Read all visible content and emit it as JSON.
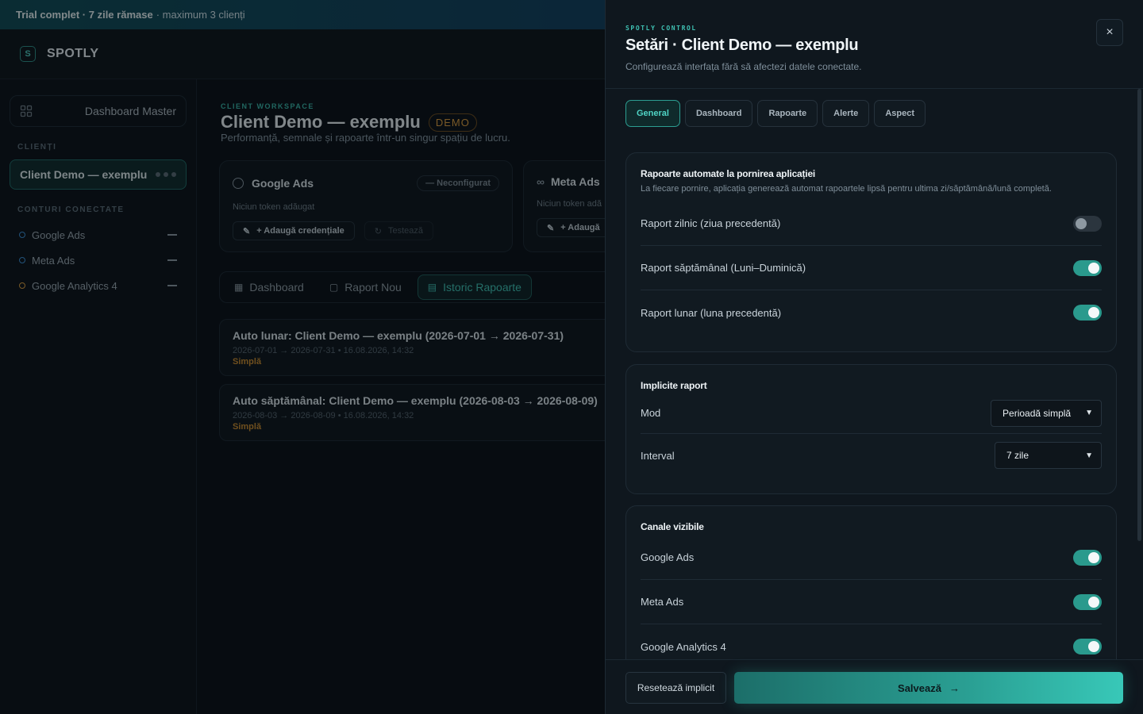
{
  "trial": {
    "bold": "Trial complet · 7 zile rămase",
    "rest": "· maximum 3 clienți"
  },
  "brand": {
    "logo": "S",
    "name": "SPOTLY"
  },
  "sidebar": {
    "dashboard_master": "Dashboard Master",
    "clients_label": "CLIENȚI",
    "active_client": "Client Demo — exemplu",
    "connected_label": "CONTURI CONECTATE",
    "accounts": [
      {
        "name": "Google Ads",
        "color": "#3b8fd6"
      },
      {
        "name": "Meta Ads",
        "color": "#3b8fd6"
      },
      {
        "name": "Google Analytics 4",
        "color": "#d99b3e"
      }
    ]
  },
  "workspace": {
    "label": "CLIENT WORKSPACE",
    "title": "Client Demo — exemplu",
    "badge": "DEMO",
    "subtitle": "Performanță, semnale și rapoarte într-un singur spațiu de lucru."
  },
  "cards": [
    {
      "name": "Google Ads",
      "status": "— Neconfigurat",
      "token": "Niciun token adăugat",
      "add": "+ Adaugă credențiale",
      "test": "Testează"
    },
    {
      "name": "Meta Ads",
      "token": "Niciun token adă",
      "add": "+ Adaugă"
    }
  ],
  "main_tabs": [
    "Dashboard",
    "Raport Nou",
    "Istoric Rapoarte"
  ],
  "reports": [
    {
      "title": "Auto lunar: Client Demo — exemplu (2026-07-01 → 2026-07-31)",
      "meta": "2026-07-01 → 2026-07-31 • 16.08.2026, 14:32",
      "kind": "Simplă"
    },
    {
      "title": "Auto săptămânal: Client Demo — exemplu (2026-08-03 → 2026-08-09)",
      "meta": "2026-08-03 → 2026-08-09 • 16.08.2026, 14:32",
      "kind": "Simplă"
    }
  ],
  "drawer": {
    "kicker": "SPOTLY CONTROL",
    "title": "Setări · Client Demo — exemplu",
    "subtitle": "Configurează interfața fără să afectezi datele conectate.",
    "close": "×",
    "tabs": [
      "General",
      "Dashboard",
      "Rapoarte",
      "Alerte",
      "Aspect"
    ],
    "auto_reports": {
      "title": "Rapoarte automate la pornirea aplicației",
      "desc": "La fiecare pornire, aplicația generează automat rapoartele lipsă pentru ultima zi/săptămână/lună completă.",
      "rows": [
        {
          "label": "Raport zilnic (ziua precedentă)",
          "on": false
        },
        {
          "label": "Raport săptămânal (Luni–Duminică)",
          "on": true
        },
        {
          "label": "Raport lunar (luna precedentă)",
          "on": true
        }
      ]
    },
    "defaults": {
      "title": "Implicite raport",
      "mode_label": "Mod",
      "mode_value": "Perioadă simplă",
      "interval_label": "Interval",
      "interval_value": "7 zile"
    },
    "channels": {
      "title": "Canale vizibile",
      "rows": [
        {
          "label": "Google Ads",
          "on": true
        },
        {
          "label": "Meta Ads",
          "on": true
        },
        {
          "label": "Google Analytics 4",
          "on": true
        }
      ]
    },
    "reset": "Resetează implicit",
    "save": "Salvează"
  }
}
